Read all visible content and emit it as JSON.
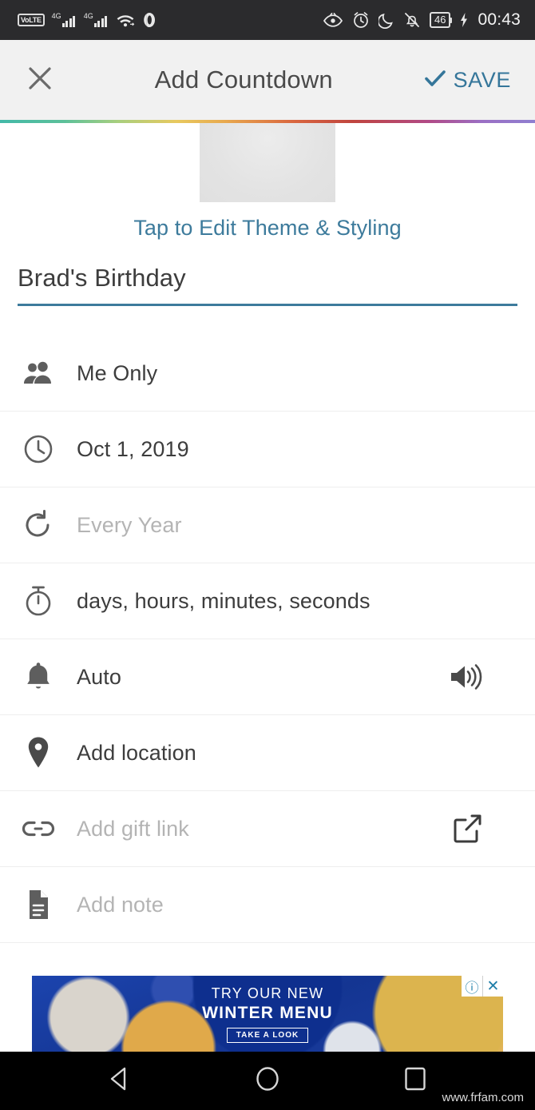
{
  "status_bar": {
    "volte_label": "VoLTE",
    "sim1_network": "4G",
    "sim2_network": "4G",
    "icons": [
      "volte-badge",
      "signal-sim1-icon",
      "signal-sim2-icon",
      "wifi-icon",
      "opera-icon",
      "eye-care-icon",
      "alarm-icon",
      "do-not-disturb-moon-icon",
      "ringer-muted-icon"
    ],
    "battery_level": "46",
    "charging": "charging-bolt-icon",
    "time": "00:43"
  },
  "app_bar": {
    "close_icon": "close-icon",
    "title": "Add Countdown",
    "save_label": "SAVE",
    "save_icon": "checkmark-icon",
    "accent_color": "#35769a"
  },
  "theme": {
    "caption": "Tap to Edit Theme & Styling"
  },
  "title_field": {
    "value": "Brad's Birthday",
    "underline_color": "#3d7b9c"
  },
  "rows": [
    {
      "icon": "people-icon",
      "label": "Me Only",
      "muted": false,
      "trailing": null
    },
    {
      "icon": "clock-icon",
      "label": "Oct 1, 2019",
      "muted": false,
      "trailing": null
    },
    {
      "icon": "repeat-icon",
      "label": "Every Year",
      "muted": true,
      "trailing": null
    },
    {
      "icon": "stopwatch-icon",
      "label": "days, hours, minutes, seconds",
      "muted": false,
      "trailing": null
    },
    {
      "icon": "bell-icon",
      "label": "Auto",
      "muted": false,
      "trailing": "volume-icon"
    },
    {
      "icon": "location-pin-icon",
      "label": "Add location",
      "muted": false,
      "trailing": null
    },
    {
      "icon": "link-icon",
      "label": "Add gift link",
      "muted": true,
      "trailing": "external-link-icon"
    },
    {
      "icon": "note-icon",
      "label": "Add note",
      "muted": true,
      "trailing": null
    }
  ],
  "ad": {
    "line1": "TRY OUR NEW",
    "line2": "WINTER MENU",
    "cta": "TAKE A LOOK",
    "adchoices_icon": "info-icon",
    "close_icon": "close-icon"
  },
  "nav_bar": {
    "back_icon": "back-triangle-icon",
    "home_icon": "home-circle-icon",
    "recents_icon": "recents-square-icon"
  },
  "watermark": "www.frfam.com"
}
